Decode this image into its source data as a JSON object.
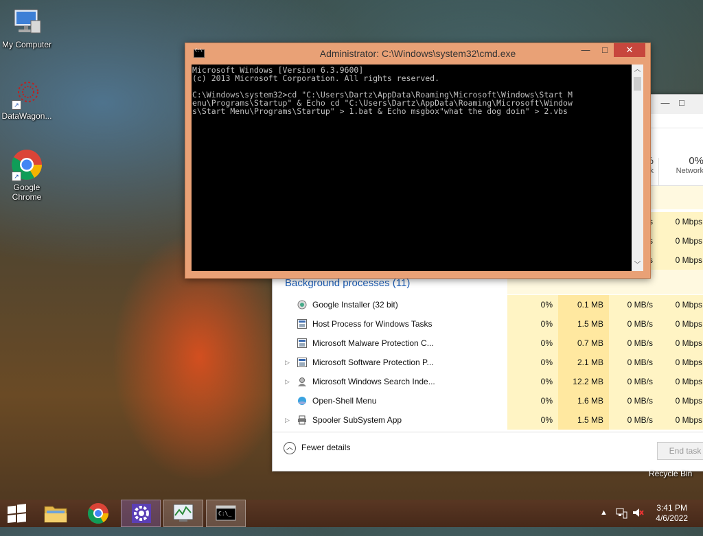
{
  "desktop": {
    "icons": [
      {
        "label": "My Computer"
      },
      {
        "label": "DataWagon..."
      },
      {
        "label": "Google Chrome"
      }
    ],
    "recycle_bin_label": "Recycle Bin"
  },
  "cmd_window": {
    "title": "Administrator: C:\\Windows\\system32\\cmd.exe",
    "minimize_glyph": "—",
    "maximize_glyph": "□",
    "close_glyph": "✕",
    "console_lines": [
      "Microsoft Windows [Version 6.3.9600]",
      "(c) 2013 Microsoft Corporation. All rights reserved.",
      "",
      "C:\\Windows\\system32>cd \"C:\\Users\\Dartz\\AppData\\Roaming\\Microsoft\\Windows\\Start M",
      "enu\\Programs\\Startup\" & Echo cd \"C:\\Users\\Dartz\\AppData\\Roaming\\Microsoft\\Window",
      "s\\Start Menu\\Programs\\Startup\" > 1.bat & Echo msgbox\"what the dog doin\" > 2.vbs"
    ]
  },
  "task_manager": {
    "partial_headers": {
      "disk_pct": "%",
      "disk_label": "k",
      "network_pct": "0%",
      "network_label": "Network"
    },
    "upper_rows": [
      {
        "disk": "s",
        "network": "0 Mbps"
      },
      {
        "disk": "s",
        "network": "0 Mbps"
      },
      {
        "disk": "s",
        "network": "0 Mbps"
      }
    ],
    "background_title": "Background processes (11)",
    "processes": [
      {
        "name": "Google Installer (32 bit)",
        "cpu": "0%",
        "memory": "0.1 MB",
        "disk": "0 MB/s",
        "network": "0 Mbps",
        "expandable": false,
        "icon": "google-installer-icon"
      },
      {
        "name": "Host Process for Windows Tasks",
        "cpu": "0%",
        "memory": "1.5 MB",
        "disk": "0 MB/s",
        "network": "0 Mbps",
        "expandable": false,
        "icon": "app-window-icon"
      },
      {
        "name": "Microsoft Malware Protection C...",
        "cpu": "0%",
        "memory": "0.7 MB",
        "disk": "0 MB/s",
        "network": "0 Mbps",
        "expandable": false,
        "icon": "app-window-icon"
      },
      {
        "name": "Microsoft Software Protection P...",
        "cpu": "0%",
        "memory": "2.1 MB",
        "disk": "0 MB/s",
        "network": "0 Mbps",
        "expandable": true,
        "icon": "app-window-icon"
      },
      {
        "name": "Microsoft Windows Search Inde...",
        "cpu": "0%",
        "memory": "12.2 MB",
        "disk": "0 MB/s",
        "network": "0 Mbps",
        "expandable": true,
        "icon": "search-indexer-icon"
      },
      {
        "name": "Open-Shell Menu",
        "cpu": "0%",
        "memory": "1.6 MB",
        "disk": "0 MB/s",
        "network": "0 Mbps",
        "expandable": false,
        "icon": "open-shell-icon"
      },
      {
        "name": "Spooler SubSystem App",
        "cpu": "0%",
        "memory": "1.5 MB",
        "disk": "0 MB/s",
        "network": "0 Mbps",
        "expandable": true,
        "icon": "printer-icon"
      }
    ],
    "fewer_details_label": "Fewer details",
    "end_task_label": "End task",
    "maximize_glyph": "□",
    "minimize_glyph": "—"
  },
  "taskbar": {
    "clock_time": "3:41 PM",
    "clock_date": "4/6/2022",
    "items": [
      "start-button",
      "file-explorer",
      "google-chrome",
      "settings",
      "performance-monitor",
      "command-prompt"
    ]
  }
}
